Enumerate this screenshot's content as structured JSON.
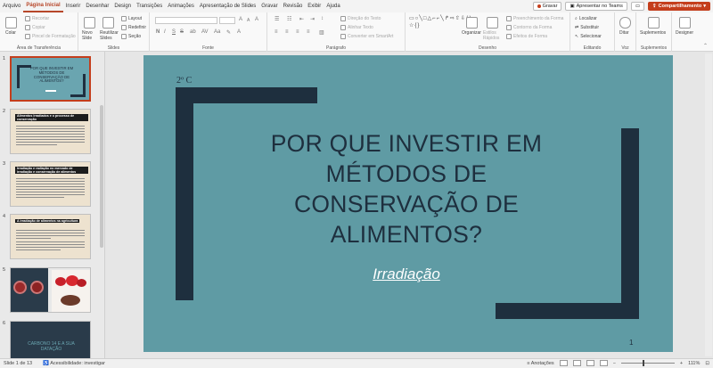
{
  "menu": {
    "tabs": [
      "Arquivo",
      "Página Inicial",
      "Inserir",
      "Desenhar",
      "Design",
      "Transições",
      "Animações",
      "Apresentação de Slides",
      "Gravar",
      "Revisão",
      "Exibir",
      "Ajuda"
    ],
    "active_tab": "Página Inicial",
    "record": "Gravar",
    "teams": "Apresentar no Teams",
    "share": "Compartilhamento"
  },
  "ribbon": {
    "clipboard": {
      "label": "Área de Transferência",
      "paste": "Colar",
      "cut": "Recortar",
      "copy": "Copiar",
      "format_painter": "Pincel de Formatação"
    },
    "slides": {
      "label": "Slides",
      "new_slide": "Novo Slide",
      "reuse": "Reutilizar Slides",
      "layout": "Layout",
      "reset": "Redefinir",
      "section": "Seção"
    },
    "font": {
      "label": "Fonte",
      "bold": "N",
      "italic": "I",
      "underline": "S"
    },
    "paragraph": {
      "label": "Parágrafo",
      "text_direction": "Direção do Texto",
      "align_text": "Alinhar Texto",
      "smartart": "Converter em SmartArt"
    },
    "drawing": {
      "label": "Desenho",
      "arrange": "Organizar",
      "quick_styles": "Estilos Rápidos",
      "fill": "Preenchimento da Forma",
      "outline": "Contorno da Forma",
      "effects": "Efeitos de Forma"
    },
    "editing": {
      "label": "Editando",
      "find": "Localizar",
      "replace": "Substituir",
      "select": "Selecionar"
    },
    "voice": {
      "label": "Voz",
      "dictate": "Ditar"
    },
    "addins": {
      "label": "Suplementos",
      "addins": "Suplementos"
    },
    "designer": {
      "label": "Designer",
      "designer": "Designer"
    }
  },
  "thumbnails": [
    {
      "number": "1",
      "title": "POR QUE INVESTIR EM MÉTODOS DE CONSERVAÇÃO DE ALIMENTOS?"
    },
    {
      "number": "2",
      "title": "Alimentos Irradiados e o processo de conservação"
    },
    {
      "number": "3",
      "title": "Irradiação e radiação no mercado de irradiação e conservação de alimentos"
    },
    {
      "number": "4",
      "title": "A irradiação de alimentos na agricultura"
    },
    {
      "number": "5",
      "title": ""
    },
    {
      "number": "6",
      "title": "CARBONO 14 E A SUA DATAÇÃO"
    }
  ],
  "slide": {
    "tag": "2º C",
    "title": "POR QUE INVESTIR EM MÉTODOS DE CONSERVAÇÃO DE ALIMENTOS?",
    "subtitle": "Irradiação",
    "page_number": "1",
    "background": "#5f9ba4",
    "accent": "#1e2f3e"
  },
  "status": {
    "slide_of": "Slide 1 de 13",
    "accessibility": "Acessibilidade: investigar",
    "notes": "Anotações",
    "zoom": "111%"
  },
  "colors": {
    "brand": "#c43e1c"
  }
}
